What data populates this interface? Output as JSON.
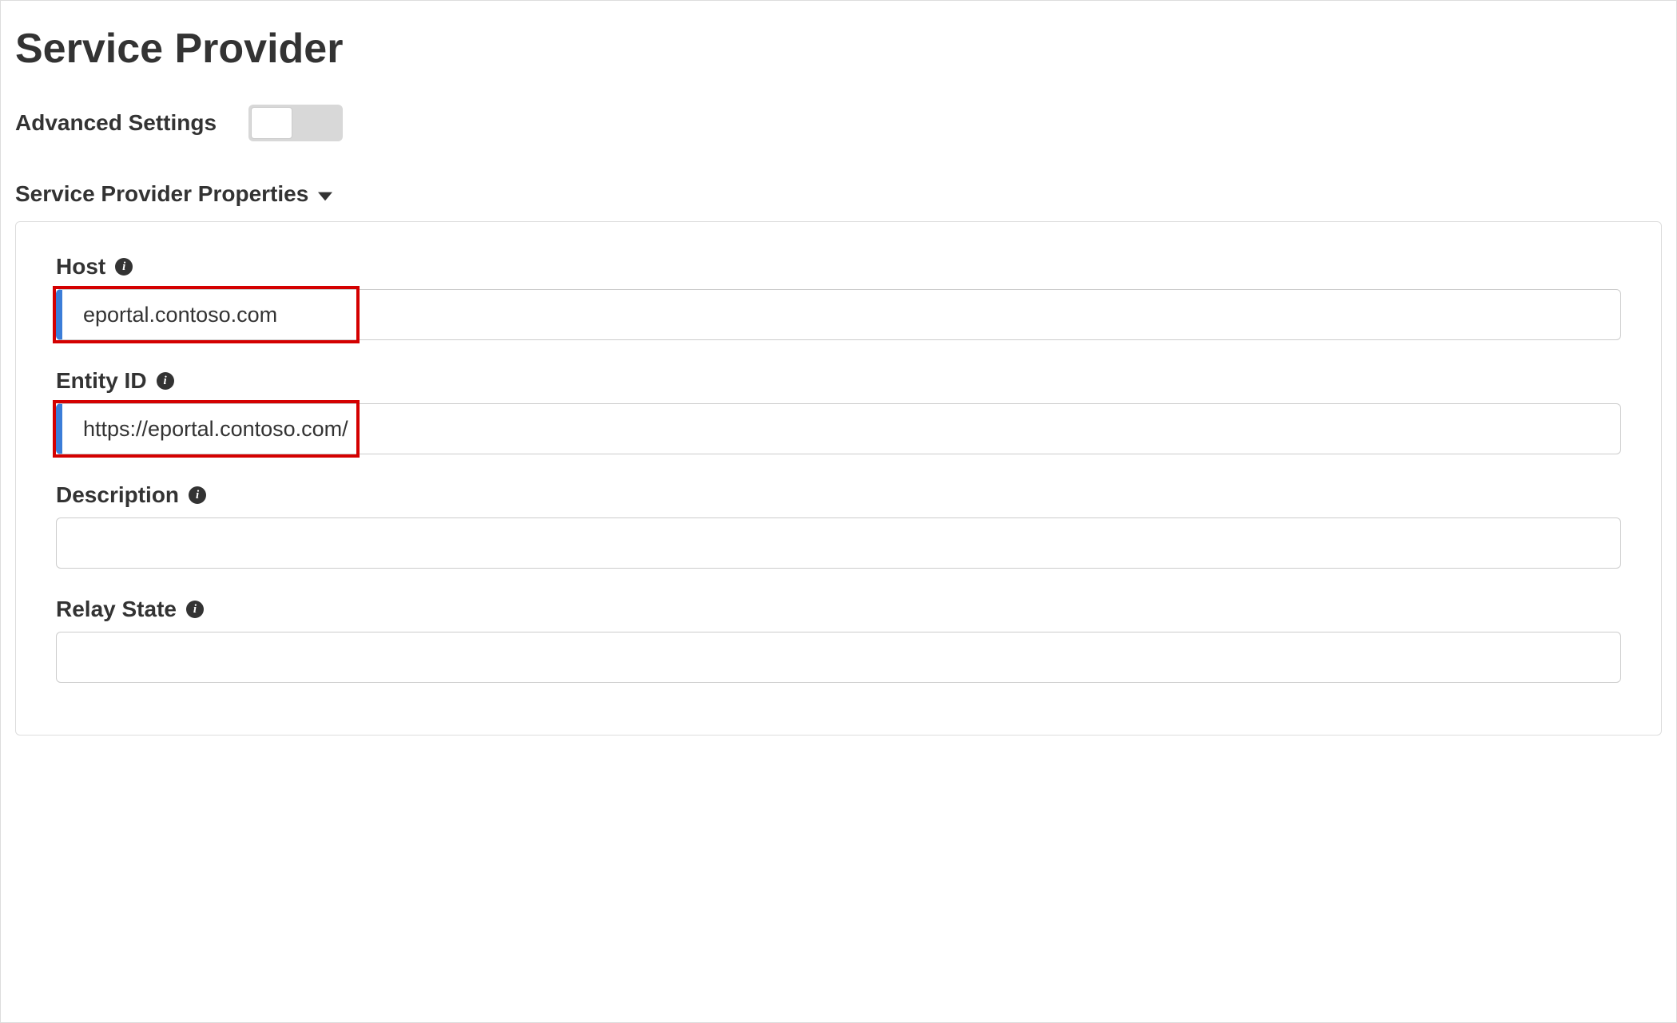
{
  "page": {
    "title": "Service Provider"
  },
  "advanced": {
    "label": "Advanced Settings",
    "enabled": false
  },
  "section": {
    "title": "Service Provider Properties"
  },
  "fields": {
    "host": {
      "label": "Host",
      "value": "eportal.contoso.com"
    },
    "entity_id": {
      "label": "Entity ID",
      "value": "https://eportal.contoso.com/"
    },
    "description": {
      "label": "Description",
      "value": ""
    },
    "relay_state": {
      "label": "Relay State",
      "value": ""
    }
  }
}
